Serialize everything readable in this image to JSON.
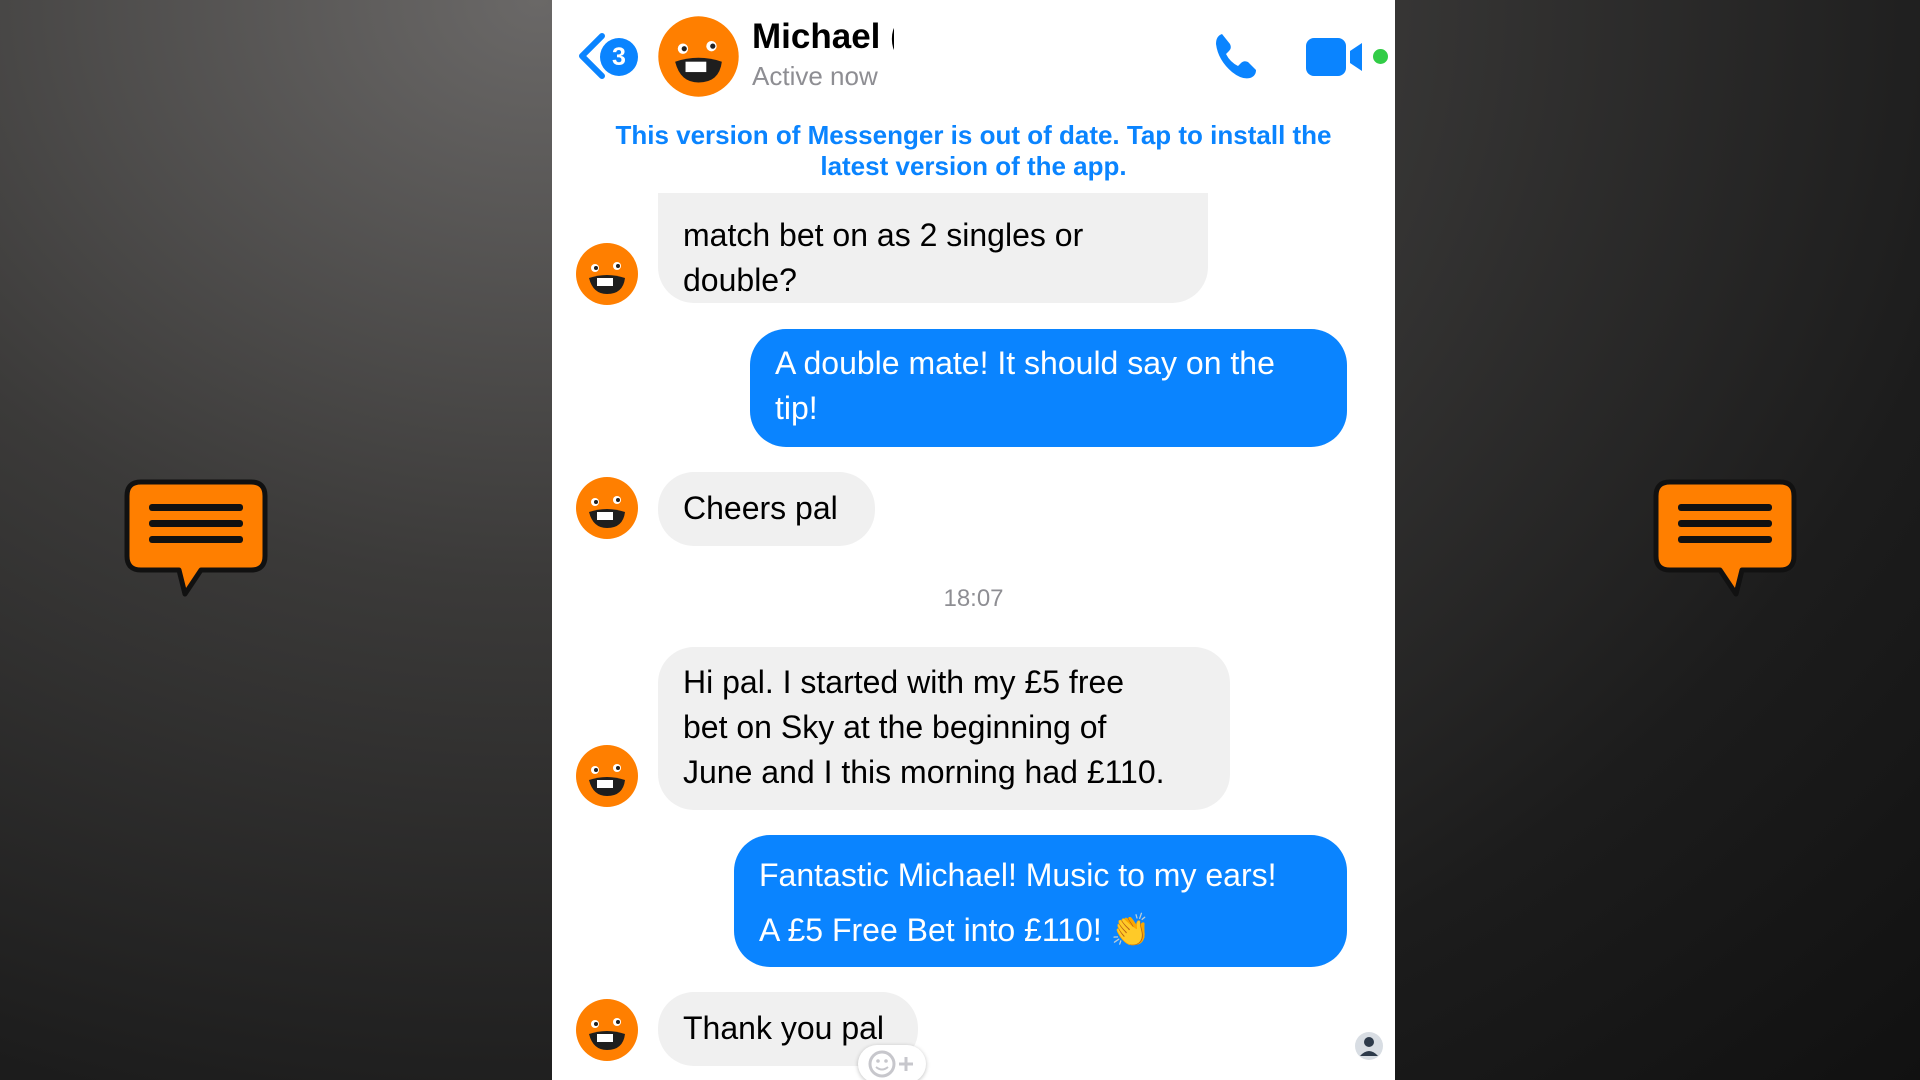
{
  "header": {
    "unread_count": "3",
    "contact_name": "Michael (",
    "status": "Active now"
  },
  "banner": {
    "text": "This version of Messenger is out of date. Tap to install the latest version of the app."
  },
  "messages": [
    {
      "from": "contact",
      "text": "match bet on as 2 singles or\ndouble?"
    },
    {
      "from": "me",
      "text": "A double mate! It should say on the\ntip!"
    },
    {
      "from": "contact",
      "text": "Cheers pal"
    },
    {
      "from": "contact",
      "text": "Hi pal. I started with my £5 free\nbet on Sky at the beginning of\nJune and I this morning had £110."
    },
    {
      "from": "me",
      "text": "Fantastic Michael! Music to my ears!\nA £5 Free Bet into £110! 👏"
    },
    {
      "from": "contact",
      "text": "Thank you pal"
    }
  ],
  "timestamp": "18:07",
  "colors": {
    "accent": "#0a84ff",
    "avatar": "#ff7f00",
    "incoming_bubble": "#f0f0f0",
    "online": "#31cc46"
  },
  "icons": [
    "back-chevron-icon",
    "phone-icon",
    "video-camera-icon",
    "chat-bubble-icon",
    "add-reaction-icon"
  ]
}
